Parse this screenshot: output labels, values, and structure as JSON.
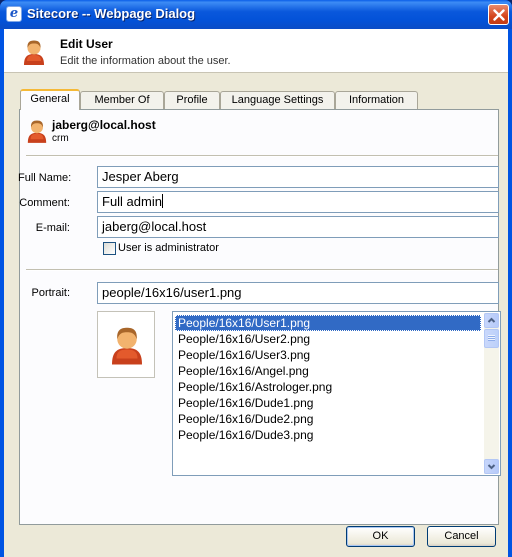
{
  "window": {
    "title": "Sitecore -- Webpage Dialog"
  },
  "header": {
    "title": "Edit User",
    "subtitle": "Edit the information about the user."
  },
  "tabs": [
    {
      "label": "General",
      "active": true
    },
    {
      "label": "Member Of"
    },
    {
      "label": "Profile"
    },
    {
      "label": "Language Settings"
    },
    {
      "label": "Information"
    }
  ],
  "user": {
    "name": "jaberg@local.host",
    "domain": "crm"
  },
  "form": {
    "full_name_label": "Full Name:",
    "full_name_value": "Jesper Aberg",
    "comment_label": "Comment:",
    "comment_value": "Full admin",
    "email_label": "E-mail:",
    "email_value": "jaberg@local.host",
    "admin_checkbox_label": "User is administrator",
    "admin_checked": false,
    "portrait_label": "Portrait:",
    "portrait_value": "people/16x16/user1.png"
  },
  "portrait_list": {
    "items": [
      "People/16x16/User1.png",
      "People/16x16/User2.png",
      "People/16x16/User3.png",
      "People/16x16/Angel.png",
      "People/16x16/Astrologer.png",
      "People/16x16/Dude1.png",
      "People/16x16/Dude2.png",
      "People/16x16/Dude3.png"
    ],
    "selected": "People/16x16/User1.png"
  },
  "buttons": {
    "ok": "OK",
    "cancel": "Cancel"
  },
  "icons": {
    "app": "ie-icon",
    "close": "close-icon",
    "user": "user-icon",
    "scroll_up": "scroll-up-icon",
    "scroll_down": "scroll-down-icon"
  },
  "colors": {
    "titlebar": "#0054e3",
    "selection": "#316ac5",
    "close": "#d4451b",
    "dialog_bg": "#ece9d8"
  }
}
